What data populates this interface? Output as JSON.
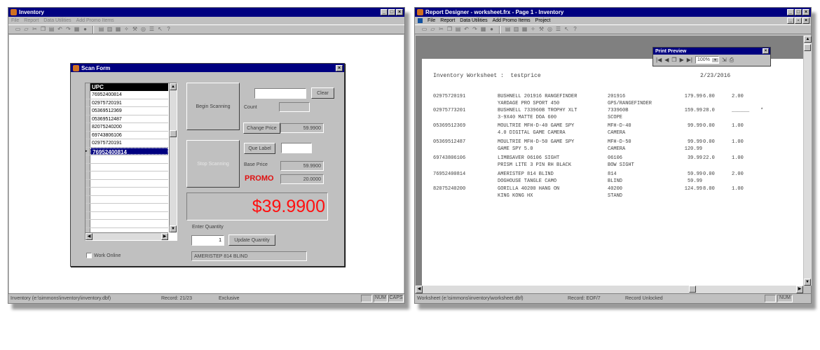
{
  "left": {
    "title": "Inventory",
    "menu": [
      "File",
      "Report",
      "Data Utilities",
      "Add Promo Items"
    ],
    "status": {
      "path": "Inventory (e:\\simmons\\inventory\\inventory.dbf)",
      "record": "Record: 21/23",
      "mode": "Exclusive",
      "num": "NUM",
      "caps": "CAPS"
    },
    "scan": {
      "title": "Scan Form",
      "grid_header": "UPC",
      "grid_rows": [
        "76952400814",
        "02975720191",
        "05369512369",
        "05369512487",
        "82075240200",
        "69743806106",
        "02975720191",
        "76952400814"
      ],
      "begin_label": "Begin Scanning",
      "stop_label": "Stop Scanning",
      "clear_label": "Clear",
      "count_label": "Count",
      "count_value": "",
      "change_price_label": "Change Price",
      "change_price_value": "59.9900",
      "que_label": "Que Label",
      "base_price_label": "Base Price",
      "base_price_value": "59.9900",
      "promo_label": "PROMO",
      "promo_value": "20.0000",
      "big_price": "$39.9900",
      "enter_qty_label": "Enter Quantity",
      "qty_value": "1",
      "update_label": "Update Quantity",
      "description": "AMERISTEP 814 BLIND",
      "work_online_label": "Work Online"
    }
  },
  "right": {
    "title": "Report Designer - worksheet.frx - Page 1 - Inventory",
    "menu": [
      "File",
      "Report",
      "Data Utilities",
      "Add Promo Items",
      "Project"
    ],
    "status": {
      "path": "Worksheet (e:\\simmons\\inventory\\worksheet.dbf)",
      "record": "Record: EOF/7",
      "lock": "Record Unlocked",
      "num": "NUM"
    },
    "preview": {
      "title": "Print Preview",
      "zoom": "100%"
    },
    "report": {
      "title": "Inventory Worksheet :  testprice",
      "date": "2/23/2016",
      "rows": [
        {
          "upc": "02975720191",
          "d1": "BUSHNELL 201916 RANGEFINDER",
          "d2": "YARDAGE PRO SPORT 450",
          "c1": "201916",
          "c2": "GPS/RANGEFINDER",
          "price": "179.99",
          "qty": "6.00",
          "x": "2.00",
          "p2": ""
        },
        {
          "upc": "02975773201",
          "d1": "BUSHNELL 733960B TROPHY XLT",
          "d2": "3-9X40 MATTE DOA 600",
          "c1": "733960B",
          "c2": "SCOPE",
          "price": "159.99",
          "qty": "28.0",
          "x": "______",
          "p2": "",
          "mark": "*"
        },
        {
          "upc": "05369512369",
          "d1": "MOULTRIE MFH-D-40 GAME SPY",
          "d2": "4.0 DIGITAL GAME CAMERA",
          "c1": "MFH-D-40",
          "c2": "CAMERA",
          "price": "99.99",
          "qty": "0.00",
          "x": "1.00",
          "p2": ""
        },
        {
          "upc": "05369512487",
          "d1": "MOULTRIE MFH-D-50 GAME SPY",
          "d2": "GAME SPY 5.0",
          "c1": "MFH-D-50",
          "c2": "CAMERA",
          "price": "99.99",
          "qty": "0.00",
          "x": "1.00",
          "p2": "120.99"
        },
        {
          "upc": "69743806106",
          "d1": "LIMBSAVER 06106 SIGHT",
          "d2": "PRISM LITE 3 PIN RH BLACK",
          "c1": "06106",
          "c2": "BOW SIGHT",
          "price": "39.99",
          "qty": "22.0",
          "x": "1.00",
          "p2": ""
        },
        {
          "upc": "76952400814",
          "d1": "AMERISTEP 814 BLIND",
          "d2": "DOGHOUSE TANGLE CAMO",
          "c1": "814",
          "c2": "BLIND",
          "price": "59.99",
          "qty": "0.00",
          "x": "2.00",
          "p2": "59.99"
        },
        {
          "upc": "82075240200",
          "d1": "GORILLA 40200 HANG ON",
          "d2": "KING KONG HX",
          "c1": "40200",
          "c2": "STAND",
          "price": "124.99",
          "qty": "8.00",
          "x": "1.00",
          "p2": ""
        }
      ]
    }
  }
}
